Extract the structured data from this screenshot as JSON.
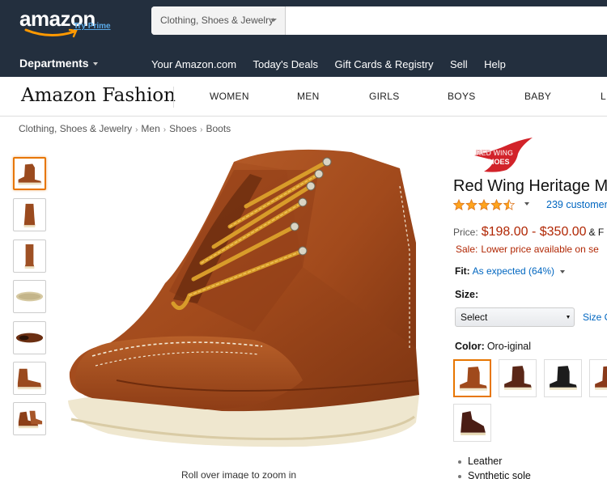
{
  "header": {
    "logo_text": "amazon",
    "logo_tagline": "Try Prime",
    "search": {
      "category": "Clothing, Shoes & Jewelry",
      "placeholder": ""
    },
    "departments_label": "Departments",
    "nav_links": [
      "Your Amazon.com",
      "Today's Deals",
      "Gift Cards & Registry",
      "Sell",
      "Help"
    ]
  },
  "fashion_nav": {
    "logo_text": "Amazon Fashion",
    "categories": [
      "WOMEN",
      "MEN",
      "GIRLS",
      "BOYS",
      "BABY",
      "L"
    ]
  },
  "breadcrumb": [
    "Clothing, Shoes & Jewelry",
    "Men",
    "Shoes",
    "Boots"
  ],
  "gallery": {
    "thumbnail_views": [
      "side",
      "front",
      "back",
      "sole",
      "top",
      "side-alt",
      "pair"
    ],
    "zoom_hint": "Roll over image to zoom in"
  },
  "product": {
    "brand_logo_text": [
      "RED WING",
      "SHOES"
    ],
    "title": "Red Wing Heritage M",
    "rating": 4.5,
    "reviews_text": "239 customer",
    "price_label": "Price:",
    "price": "$198.00 - $350.00",
    "price_suffix": "& F",
    "sale_label": "Sale:",
    "sale_text": "Lower price available on se",
    "fit_label": "Fit:",
    "fit_value": "As expected (64%)",
    "size_label": "Size:",
    "size_select_value": "Select",
    "size_chart_link": "Size C",
    "color_label": "Color:",
    "color_value": "Oro-iginal",
    "swatches": [
      "Oro-iginal",
      "Briar Oil Slick",
      "Black",
      "Copper",
      "Black Cherry"
    ],
    "bullets": [
      "Leather",
      "Synthetic sole"
    ]
  },
  "colors": {
    "header_bg": "#232f3e",
    "price_red": "#b12704",
    "link_blue": "#0066c0",
    "selected_orange": "#e77600",
    "star_gold": "#ffa41c"
  }
}
